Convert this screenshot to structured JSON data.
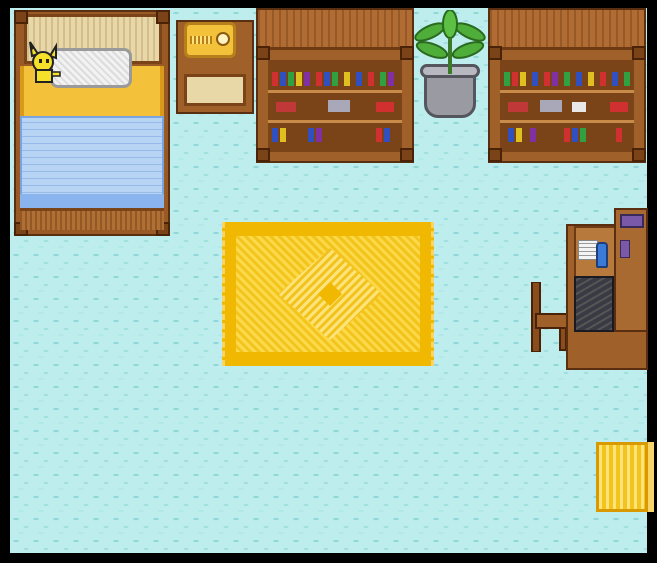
{
  "scene": {
    "type": "pixel-art bedroom interior",
    "colors": {
      "floor": "#bdeeed",
      "wood": "#a0602a",
      "rug": "#f0b800",
      "blanket": "#b8d4f4",
      "pichu": "#f5e12a"
    },
    "objects": [
      "bed",
      "pillow",
      "pichu",
      "nightstand",
      "radio",
      "bookshelf-left",
      "bookshelf-right",
      "potted-plant",
      "rug",
      "desk",
      "chair",
      "computer",
      "exit-mat"
    ]
  }
}
